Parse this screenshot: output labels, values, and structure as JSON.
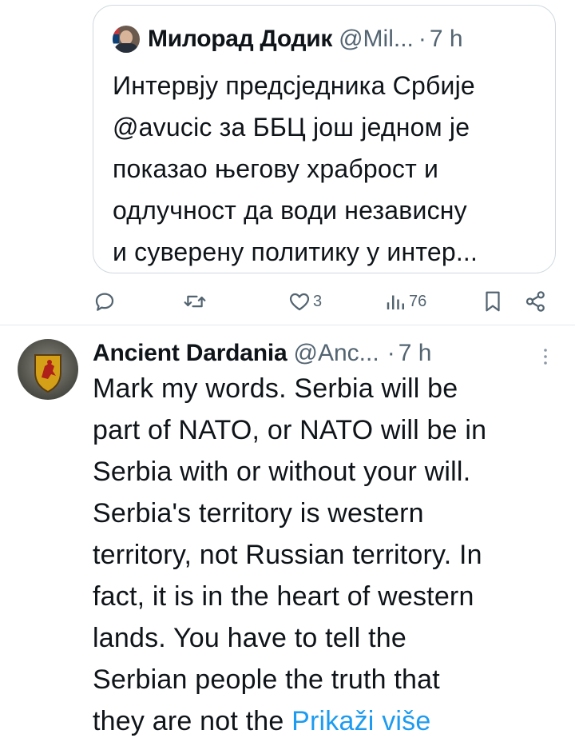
{
  "quoted_tweet": {
    "author_name": "Милорад Додик",
    "handle": "@Mil...",
    "separator": "·",
    "time": "7 h",
    "text": "Интервју предсједника Србије\n@avucic за ББЦ још једном је\nпоказао његову храброст и\nодлучност да води независну\nи суверену политику у интер..."
  },
  "actions": {
    "reply_icon": "reply-icon",
    "retweet_icon": "retweet-icon",
    "like_icon": "heart-icon",
    "like_count": "3",
    "views_icon": "views-icon",
    "views_count": "76",
    "bookmark_icon": "bookmark-icon",
    "share_icon": "share-icon"
  },
  "reply_tweet": {
    "author_name": "Ancient Dardania",
    "handle": "@Anc...",
    "separator": "·",
    "time": "7 h",
    "text": "Mark my words. Serbia will be\npart of NATO, or NATO will be in\nSerbia with or without your will.\nSerbia's territory is western\nterritory, not Russian territory. In\nfact, it is in the heart of western\nlands. You have to tell the\nSerbian people the truth that\nthey are not the ",
    "show_more": "Prikaži više"
  },
  "colors": {
    "text": "#0f1419",
    "secondary": "#536471",
    "link": "#1d9bf0",
    "border": "#cfd9de"
  }
}
